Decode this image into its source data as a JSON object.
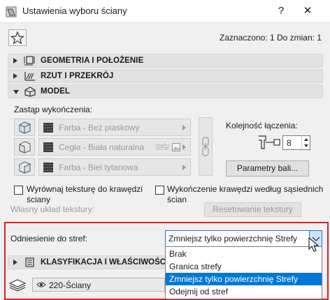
{
  "window": {
    "title": "Ustawienia wyboru ściany",
    "help_label": "?",
    "close_label": "✕"
  },
  "header": {
    "selected_count": "Zaznaczono: 1 Do zmian: 1"
  },
  "sections": {
    "geometry": "GEOMETRIA I POŁOŻENIE",
    "plan": "RZUT I PRZEKRÓJ",
    "model": "MODEL",
    "classification": "KLASYFIKACJA I WŁAŚCIWOŚCI"
  },
  "model": {
    "override_label": "Zastąp wykończenia:",
    "materials": [
      "Farba - Beż piaskowy",
      "Cegła - Biała naturalna",
      "Farba - Biel tytanowa"
    ],
    "join_order_label": "Kolejność łączenia:",
    "join_order_value": "8",
    "params_button": "Parametry bali...",
    "align_texture_label": "Wyrównaj teksturę do krawędzi ściany",
    "edge_finish_label": "Wykończenie krawędzi według sąsiednich ścian",
    "custom_texture_label": "Własny układ tekstury:",
    "reset_texture_button": "Resetowanie tekstury"
  },
  "zones": {
    "label": "Odniesienie do stref:",
    "selected": "Zmniejsz tylko powierzchnię Strefy",
    "options": [
      "Brak",
      "Granica strefy",
      "Zmniejsz tylko powierzchnię Strefy",
      "Odejmij od stref"
    ],
    "selected_index": 2
  },
  "layer": {
    "value": "220-Ściany"
  },
  "colors": {
    "accent": "#0078d7",
    "highlight_frame": "#e02020"
  }
}
